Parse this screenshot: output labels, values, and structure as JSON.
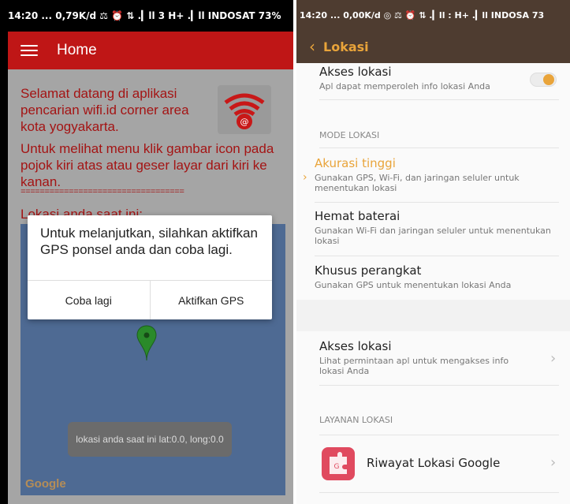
{
  "left_phone": {
    "status_bar": {
      "text": "14:20 ... 0,79K/d ⚖ ⏰ ⇅ .▎ll 3 H+ .▎ll INDOSAT 73%"
    },
    "app_bar": {
      "title": "Home"
    },
    "welcome_text": "Selamat datang di aplikasi pencarian wifi.id corner area kota yogyakarta.",
    "instruction_text": "Untuk melihat menu klik gambar icon pada pojok kiri atas atau geser layar dari kiri ke kanan.",
    "divider": "==================================",
    "location_label": "Lokasi anda saat ini:",
    "map": {
      "watermark": "Google"
    },
    "toast": "lokasi anda saat ini lat:0.0, long:0.0",
    "dialog": {
      "message": "Untuk melanjutkan, silahkan aktifkan GPS ponsel anda dan coba lagi.",
      "retry_label": "Coba lagi",
      "enable_gps_label": "Aktifkan GPS"
    },
    "colors": {
      "app_bar": "#bf1616",
      "text": "#a41414",
      "pin": "#2a8a2a"
    }
  },
  "right_phone": {
    "status_bar": {
      "text": "14:20 ... 0,00K/d ◎ ⚖ ⏰ ⇅ .▎ll : H+ .▎ll INDOSA 73"
    },
    "app_bar": {
      "back_icon": "chevron-left-icon",
      "title": "Lokasi"
    },
    "akses_lokasi_toggle": {
      "title": "Akses lokasi",
      "subtitle": "Apl dapat memperoleh info lokasi Anda",
      "on": true
    },
    "mode_header": "MODE LOKASI",
    "modes": [
      {
        "title": "Akurasi tinggi",
        "subtitle": "Gunakan GPS, Wi-Fi, dan jaringan seluler untuk menentukan lokasi",
        "selected": true
      },
      {
        "title": "Hemat baterai",
        "subtitle": "Gunakan Wi-Fi dan jaringan seluler untuk menentukan lokasi",
        "selected": false
      },
      {
        "title": "Khusus perangkat",
        "subtitle": "Gunakan GPS untuk menentukan lokasi Anda",
        "selected": false
      }
    ],
    "akses_lokasi_link": {
      "title": "Akses lokasi",
      "subtitle": "Lihat permintaan apl untuk mengakses info lokasi Anda"
    },
    "services_header": "LAYANAN LOKASI",
    "service": {
      "title": "Riwayat Lokasi Google"
    },
    "colors": {
      "app_bar": "#4e3c30",
      "accent": "#e9a43a"
    }
  }
}
